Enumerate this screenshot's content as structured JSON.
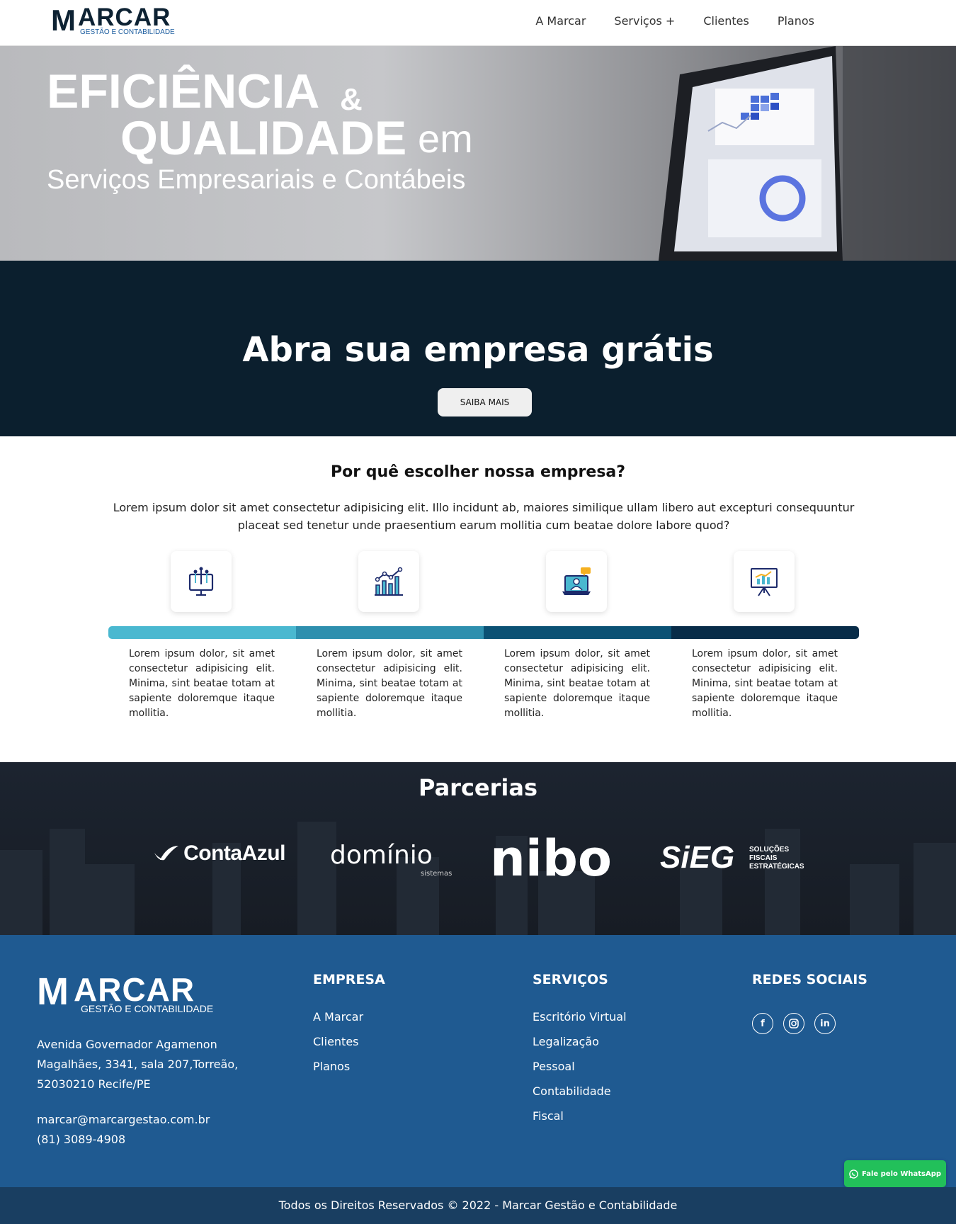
{
  "nav": {
    "logo_initial": "M",
    "logo_word": "ARCAR",
    "logo_sub": "GESTÃO E CONTABILIDADE",
    "links": [
      "A Marcar",
      "Serviços +",
      "Clientes",
      "Planos"
    ]
  },
  "hero": {
    "line1": "EFICIÊNCIA",
    "amp": "&",
    "line2": "QUALIDADE",
    "em": "em",
    "line3": "Serviços Empresariais e Contábeis"
  },
  "cta": {
    "title": "Abra sua empresa grátis",
    "button": "SAIBA MAIS"
  },
  "why": {
    "title": "Por quê escolher nossa empresa?",
    "text": "Lorem ipsum dolor sit amet consectetur adipisicing elit. Illo incidunt ab, maiores similique ullam libero aut excepturi consequuntur placeat sed tenetur unde praesentium earum mollitia cum beatae dolore labore quod?",
    "features": [
      {
        "icon": "monitor-network-icon",
        "color": "#4ab8d0",
        "text": "Lorem ipsum dolor, sit amet consectetur adipisicing elit. Minima, sint beatae totam at sapiente doloremque itaque mollitia."
      },
      {
        "icon": "bar-chart-icon",
        "color": "#2e8fae",
        "text": "Lorem ipsum dolor, sit amet consectetur adipisicing elit. Minima, sint beatae totam at sapiente doloremque itaque mollitia."
      },
      {
        "icon": "laptop-support-icon",
        "color": "#0b5174",
        "text": "Lorem ipsum dolor, sit amet consectetur adipisicing elit. Minima, sint beatae totam at sapiente doloremque itaque mollitia."
      },
      {
        "icon": "presentation-board-icon",
        "color": "#082c48",
        "text": "Lorem ipsum dolor, sit amet consectetur adipisicing elit. Minima, sint beatae totam at sapiente doloremque itaque mollitia."
      }
    ]
  },
  "partners": {
    "title": "Parcerias",
    "logos": {
      "contaazul": "ContaAzul",
      "dominio": "domínio",
      "dominio_sub": "sistemas",
      "nibo": "nibo",
      "sieg": "SiEG",
      "sieg_sub": [
        "SOLUÇÕES",
        "FISCAIS",
        "ESTRATÉGICAS"
      ]
    }
  },
  "footer": {
    "logo_initial": "M",
    "logo_word": "ARCAR",
    "logo_sub": "GESTÃO E CONTABILIDADE",
    "address": "Avenida Governador Agamenon Magalhães, 3341, sala 207,Torreão, 52030210 Recife/PE",
    "email": "marcar@marcargestao.com.br",
    "phone": "(81) 3089-4908",
    "empresa_title": "EMPRESA",
    "empresa_links": [
      "A Marcar",
      "Clientes",
      "Planos"
    ],
    "servicos_title": "SERVIÇOS",
    "servicos_links": [
      "Escritório Virtual",
      "Legalização",
      "Pessoal",
      "Contabilidade",
      "Fiscal"
    ],
    "redes_title": "REDES SOCIAIS",
    "social_icons": [
      "facebook-icon",
      "instagram-icon",
      "linkedin-icon"
    ]
  },
  "whatsapp": "Fale pelo WhatsApp",
  "copyright": "Todos os Direitos Reservados © 2022 - Marcar Gestão e Contabilidade",
  "colors": {
    "navy": "#0b1f2e",
    "footer_blue": "#1f5a91",
    "copyright_blue": "#193e61",
    "whatsapp_green": "#22c05a"
  }
}
